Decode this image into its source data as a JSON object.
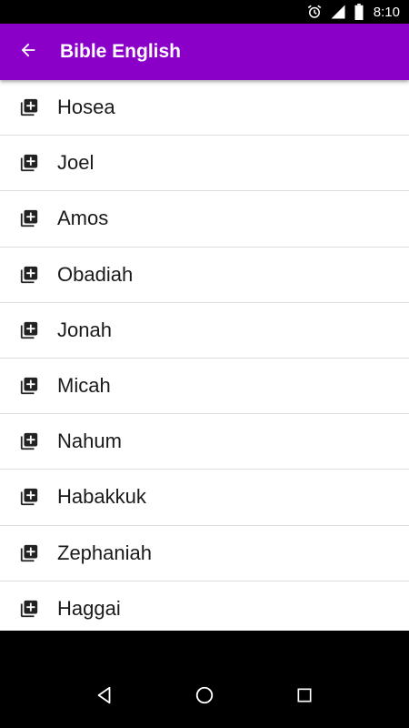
{
  "status_bar": {
    "time": "8:10",
    "icons": [
      "alarm-icon",
      "signal-icon",
      "battery-icon"
    ]
  },
  "app_bar": {
    "title": "Bible English",
    "back_icon": "arrow-back-icon",
    "color": "#8a00c8"
  },
  "books": [
    {
      "label": "Hosea",
      "icon": "library-add-icon"
    },
    {
      "label": "Joel",
      "icon": "library-add-icon"
    },
    {
      "label": "Amos",
      "icon": "library-add-icon"
    },
    {
      "label": "Obadiah",
      "icon": "library-add-icon"
    },
    {
      "label": "Jonah",
      "icon": "library-add-icon"
    },
    {
      "label": "Micah",
      "icon": "library-add-icon"
    },
    {
      "label": "Nahum",
      "icon": "library-add-icon"
    },
    {
      "label": "Habakkuk",
      "icon": "library-add-icon"
    },
    {
      "label": "Zephaniah",
      "icon": "library-add-icon"
    },
    {
      "label": "Haggai",
      "icon": "library-add-icon"
    }
  ],
  "nav_bar": {
    "buttons": [
      "back-triangle-icon",
      "home-circle-icon",
      "recents-square-icon"
    ]
  }
}
